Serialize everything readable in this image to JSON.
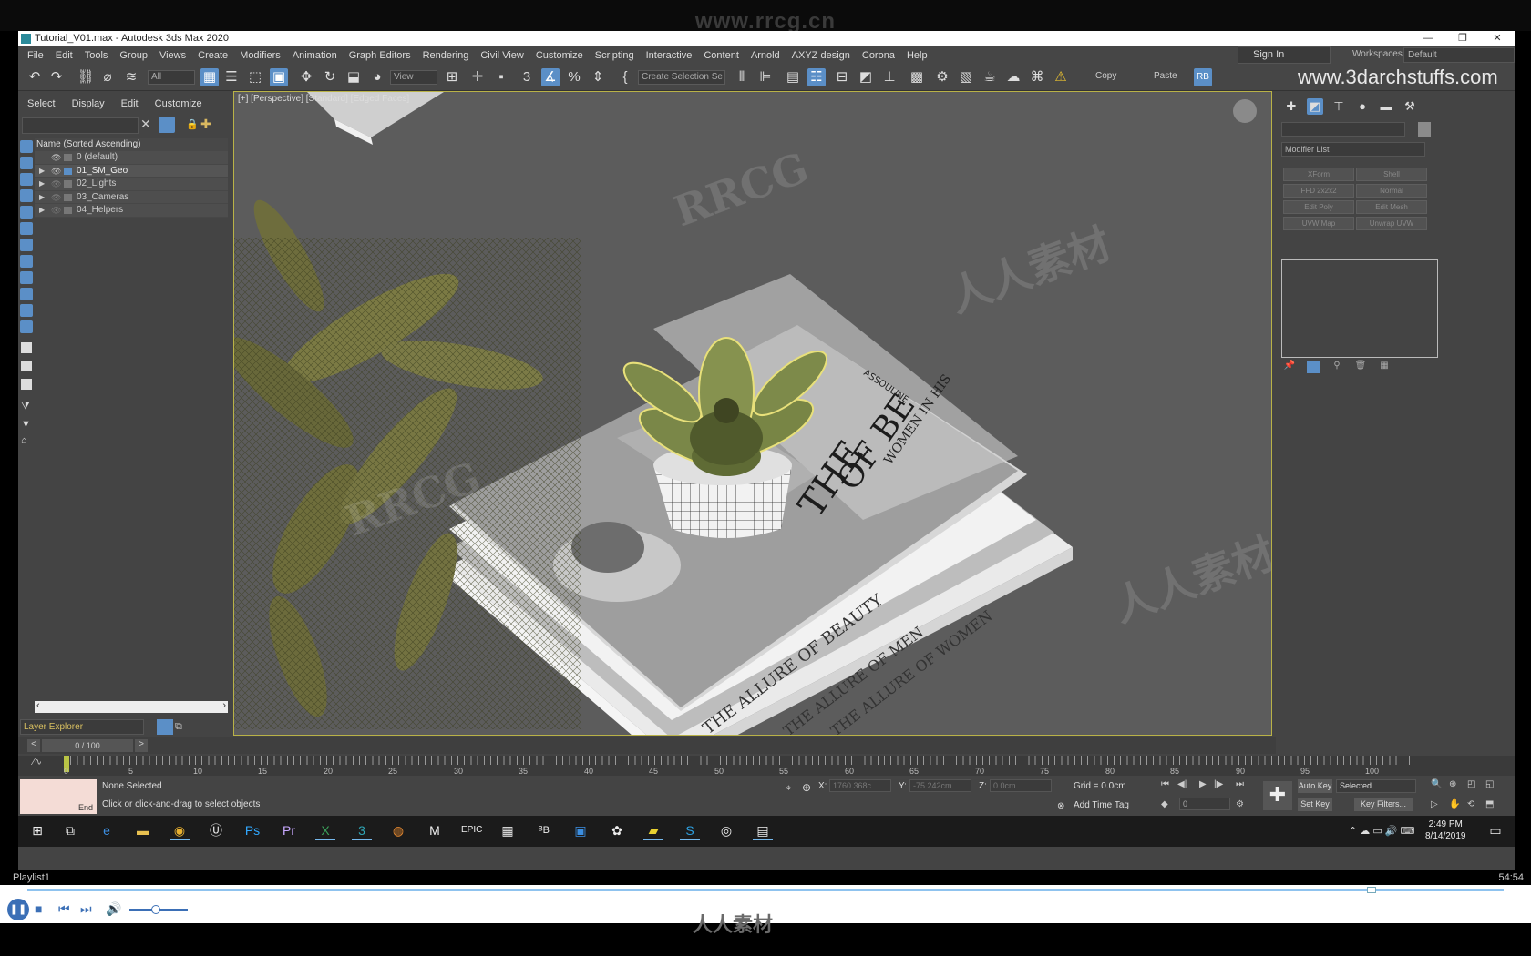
{
  "site_watermark_top": "www.rrcg.cn",
  "site_watermark_bottom": "人人素材",
  "window": {
    "title": "Tutorial_V01.max - Autodesk 3ds Max 2020",
    "min": "—",
    "restore": "❐",
    "close": "✕"
  },
  "menu": [
    "File",
    "Edit",
    "Tools",
    "Group",
    "Views",
    "Create",
    "Modifiers",
    "Animation",
    "Graph Editors",
    "Rendering",
    "Civil View",
    "Customize",
    "Scripting",
    "Interactive",
    "Content",
    "Arnold",
    "AXYZ design",
    "Corona",
    "Help"
  ],
  "signin": "Sign In",
  "workspaces_label": "Workspaces:",
  "workspaces_value": "Default",
  "toolbar": {
    "filter_value": "All",
    "refcoord_value": "View",
    "selection_set_value": "Create Selection Se",
    "copy_label": "Copy",
    "paste_label": "Paste",
    "site_watermark": "www.3darchstuffs.com"
  },
  "explorer": {
    "tabs": [
      "Select",
      "Display",
      "Edit",
      "Customize"
    ],
    "header": "Name (Sorted Ascending)",
    "rows": [
      "0 (default)",
      "01_SM_Geo",
      "02_Lights",
      "03_Cameras",
      "04_Helpers"
    ],
    "footer_label": "Layer Explorer"
  },
  "viewport": {
    "label": "[+] [Perspective] [Standard] [Edged Faces]",
    "book_text": [
      "THE ALLURE OF BEAUTY",
      "THE ALLURE OF MEN",
      "THE ALLURE OF WOMEN",
      "THE",
      "OF BE",
      "WOMEN IN HIS",
      "ASSOULINE"
    ],
    "watermarks": [
      "RRCG",
      "人人素材"
    ]
  },
  "command_panel": {
    "modifier_list": "Modifier List",
    "buttons": [
      "XForm",
      "Shell",
      "FFD 2x2x2",
      "Normal",
      "Edit Poly",
      "Edit Mesh",
      "UVW Map",
      "Unwrap UVW"
    ]
  },
  "time": {
    "frame": "0 / 100",
    "ticks": [
      "0",
      "5",
      "10",
      "15",
      "20",
      "25",
      "30",
      "35",
      "40",
      "45",
      "50",
      "55",
      "60",
      "65",
      "70",
      "75",
      "80",
      "85",
      "90",
      "95",
      "100"
    ]
  },
  "status": {
    "maxscript_end": "End",
    "selection": "None Selected",
    "prompt": "Click or click-and-drag to select objects",
    "x_label": "X:",
    "x_value": "1760.368c",
    "y_label": "Y:",
    "y_value": "-75.242cm",
    "z_label": "Z:",
    "z_value": "0.0cm",
    "grid": "Grid = 0.0cm",
    "add_time_tag": "Add Time Tag",
    "auto_key": "Auto Key",
    "set_key": "Set Key",
    "key_mode": "Selected",
    "key_filters": "Key Filters...",
    "current_frame": "0"
  },
  "taskbar": {
    "time": "2:49 PM",
    "date": "8/14/2019"
  },
  "player": {
    "playlist": "Playlist1",
    "duration": "54:54"
  }
}
